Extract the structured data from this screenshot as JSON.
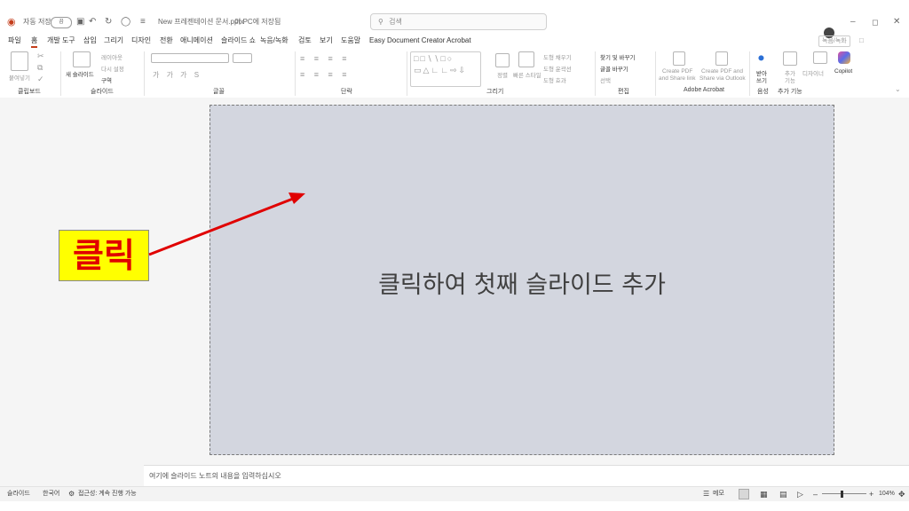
{
  "titlebar": {
    "autosave_label": "자동 저장",
    "autosave_state": "끔",
    "file_name": "New 프레젠테이션 문서.pptx",
    "location": "이 PC에 저장됨",
    "search_placeholder": "검색"
  },
  "menu": {
    "items": [
      "파일",
      "홈",
      "개발 도구",
      "삽입",
      "그리기",
      "디자인",
      "전환",
      "애니메이션",
      "슬라이드 쇼",
      "녹음/녹화",
      "검토",
      "보기",
      "도움말",
      "Easy Document Creator",
      "Acrobat"
    ],
    "active_index": 1,
    "record_label": "녹음/녹화",
    "share_label": "공유"
  },
  "ribbon": {
    "groups": {
      "clipboard": "클립보드",
      "slides": "슬라이드",
      "font": "글꼴",
      "paragraph": "단락",
      "drawing": "그리기",
      "editing": "편집",
      "acrobat": "Adobe Acrobat",
      "voice": "음성",
      "addins": "추가 기능"
    },
    "paste_label": "붙여넣기",
    "new_slide_label": "새 슬라이드",
    "layout_label": "레이아웃",
    "reset_label": "다시 설정",
    "section_label": "구역",
    "arrange_label": "정렬",
    "quick_styles_label": "빠른 스타일",
    "shape_fill_label": "도형 채우기",
    "shape_outline_label": "도형 윤곽선",
    "shape_effects_label": "도형 효과",
    "find_label": "찾기 및 바꾸기",
    "replace_font_label": "글꼴 바꾸기",
    "select_label": "선택",
    "create_pdf_link_1": "Create PDF",
    "create_pdf_link_2": "and Share link",
    "create_pdf_outlook_1": "Create PDF and",
    "create_pdf_outlook_2": "Share via Outlook",
    "dictate_label_1": "받아",
    "dictate_label_2": "쓰기",
    "addins_label_1": "추가",
    "addins_label_2": "기능",
    "designer_label": "디자이너",
    "copilot_label": "Copilot"
  },
  "slide": {
    "placeholder": "클릭하여 첫째 슬라이드 추가"
  },
  "notes": {
    "placeholder": "여기에 슬라이드 노트의 내용을 입력하십시오"
  },
  "status": {
    "slide_label": "슬라이드",
    "language": "한국어",
    "accessibility": "접근성: 계속 진행 가능",
    "notes_label": "메모",
    "zoom": "104%"
  },
  "callout": {
    "text": "클릭"
  },
  "colors": {
    "accent": "#c43e1c",
    "slide_bg": "#d3d6df",
    "callout_bg": "#ffff00",
    "callout_text": "#e00000",
    "arrow": "#e00000"
  }
}
